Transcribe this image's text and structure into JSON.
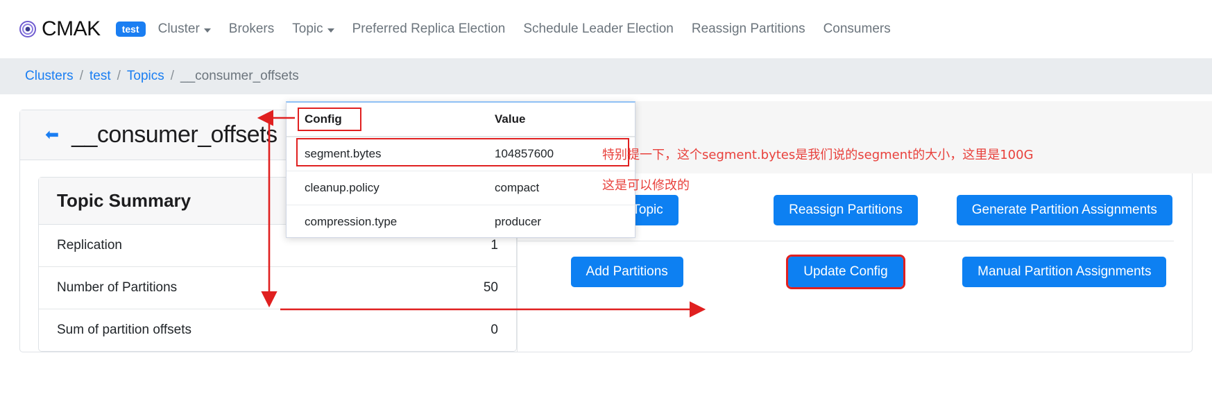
{
  "navbar": {
    "brand": "CMAK",
    "brand_icon": "target-circle-icon",
    "cluster_badge": "test",
    "links": [
      {
        "label": "Cluster",
        "caret": true
      },
      {
        "label": "Brokers",
        "caret": false
      },
      {
        "label": "Topic",
        "caret": true
      },
      {
        "label": "Preferred Replica Election",
        "caret": false
      },
      {
        "label": "Schedule Leader Election",
        "caret": false
      },
      {
        "label": "Reassign Partitions",
        "caret": false
      },
      {
        "label": "Consumers",
        "caret": false
      }
    ]
  },
  "breadcrumb": {
    "items": [
      "Clusters",
      "test",
      "Topics",
      "__consumer_offsets"
    ],
    "separator": "/"
  },
  "page": {
    "back_icon": "back-arrow-icon",
    "title": "__consumer_offsets"
  },
  "summary": {
    "heading": "Topic Summary",
    "rows": [
      {
        "label": "Replication",
        "value": "1"
      },
      {
        "label": "Number of Partitions",
        "value": "50"
      },
      {
        "label": "Sum of partition offsets",
        "value": "0"
      }
    ]
  },
  "actions": {
    "rows": [
      [
        "Delete Topic",
        "Reassign Partitions",
        "Generate Partition Assignments"
      ],
      [
        "Add Partitions",
        "Update Config",
        "Manual Partition Assignments"
      ]
    ],
    "highlighted": "Update Config"
  },
  "config_popup": {
    "headers": [
      "Config",
      "Value"
    ],
    "rows": [
      {
        "config": "segment.bytes",
        "value": "104857600"
      },
      {
        "config": "cleanup.policy",
        "value": "compact"
      },
      {
        "config": "compression.type",
        "value": "producer"
      }
    ],
    "highlighted_rows": [
      "segment.bytes"
    ],
    "highlighted_header": "Config"
  },
  "annotations": [
    {
      "text": "特别提一下，这个segment.bytes是我们说的segment的大小，这里是100G"
    },
    {
      "text": "这是可以修改的"
    }
  ],
  "colors": {
    "primary_blue": "#0d80f2",
    "link_blue": "#1a7ef2",
    "annotation_red": "#e8413c",
    "highlight_red": "#e02020",
    "breadcrumb_bg": "#e9ecef"
  }
}
